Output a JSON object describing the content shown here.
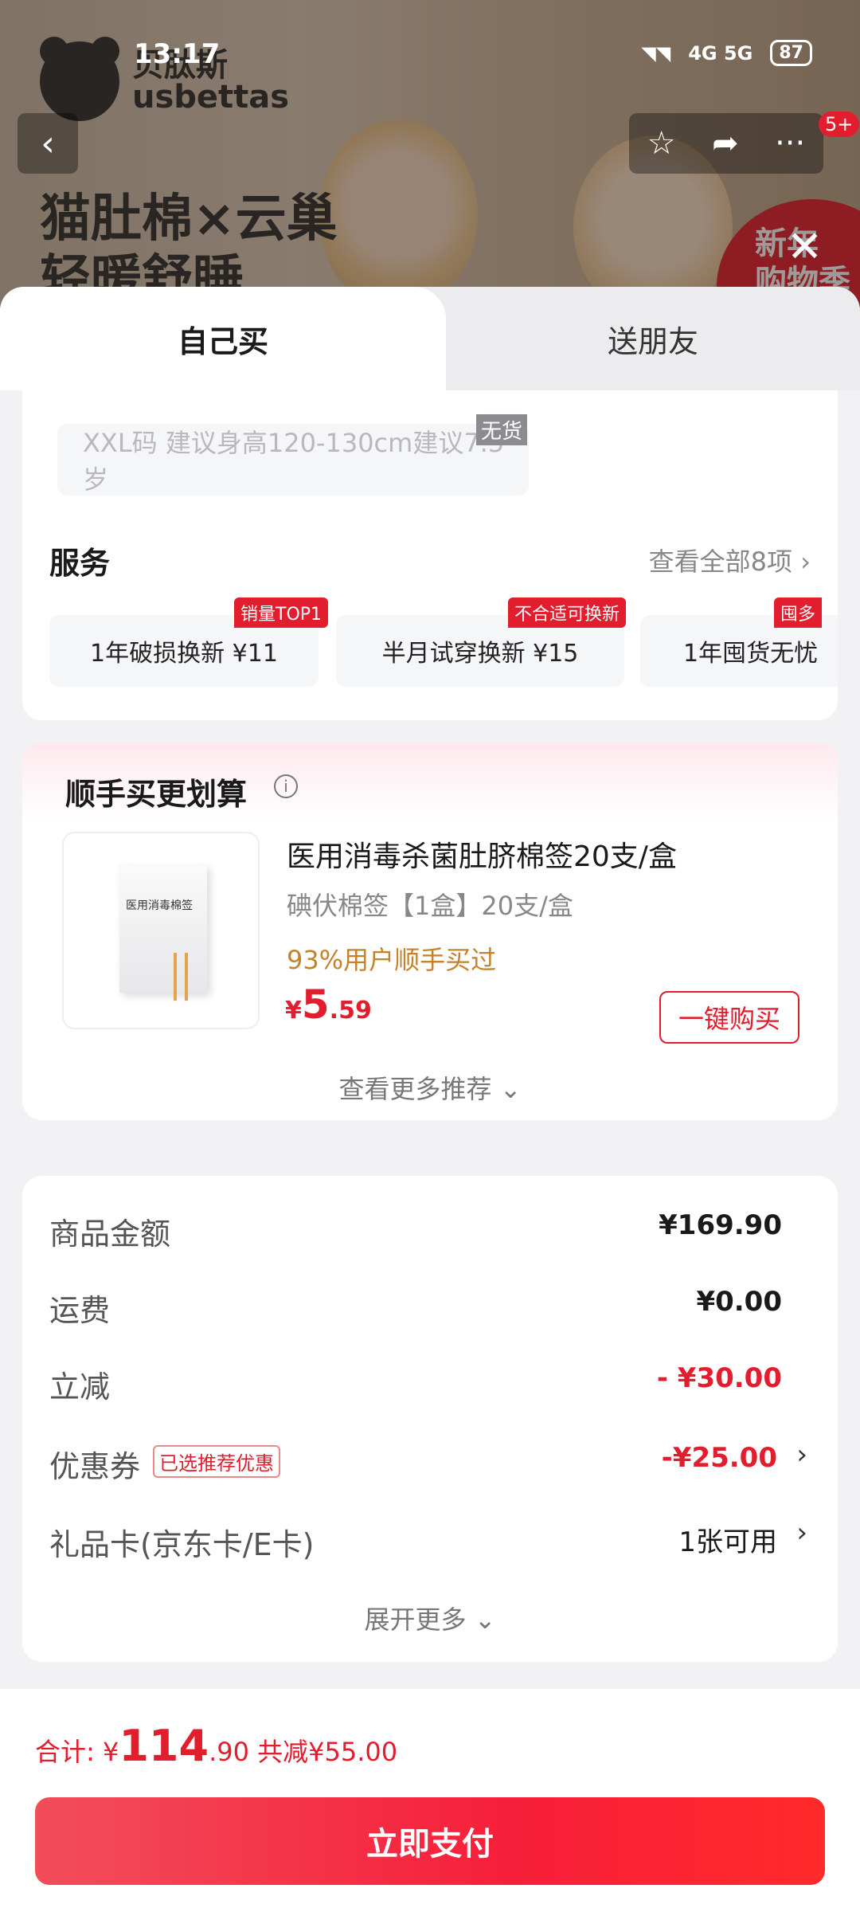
{
  "status_bar": {
    "time": "13:17",
    "network": "4G 5G",
    "battery": "87"
  },
  "banner": {
    "brand_cn": "贝肽斯",
    "brand_en": "usbettas",
    "slogan_line1": "猫肚棉×云巢",
    "slogan_line2": "轻暖舒睡",
    "promo_line1": "新年",
    "promo_line2": "购物季",
    "msg_badge": "5+"
  },
  "tabs": {
    "self": "自己买",
    "friend": "送朋友"
  },
  "size_option": {
    "label": "XXL码 建议身高120-130cm建议7.5岁",
    "stock_tag": "无货"
  },
  "service": {
    "title": "服务",
    "view_all": "查看全部8项",
    "items": [
      {
        "label": "1年破损换新  ¥11",
        "tag": "销量TOP1"
      },
      {
        "label": "半月试穿换新  ¥15",
        "tag": "不合适可换新"
      },
      {
        "label": "1年囤货无忧",
        "tag": "囤多"
      }
    ]
  },
  "addon": {
    "title": "顺手买更划算",
    "product_name": "医用消毒杀菌肚脐棉签20支/盒",
    "product_spec": "碘伏棉签【1盒】20支/盒",
    "buyers": "93%用户顺手买过",
    "price_currency": "¥",
    "price_int": "5",
    "price_dec": ".59",
    "buy_button": "一键购买",
    "more": "查看更多推荐",
    "box_label": "医用消毒棉签"
  },
  "summary": {
    "goods_label": "商品金额",
    "goods_value": "¥169.90",
    "shipping_label": "运费",
    "shipping_value": "¥0.00",
    "discount_label": "立减",
    "discount_value": "- ¥30.00",
    "coupon_label": "优惠券",
    "coupon_tag": "已选推荐优惠",
    "coupon_value": "-¥25.00",
    "giftcard_label": "礼品卡(京东卡/E卡)",
    "giftcard_value": "1张可用",
    "expand": "展开更多"
  },
  "footer": {
    "total_label": "合计: ",
    "total_currency": "¥",
    "total_int": "114",
    "total_dec": ".90",
    "total_saved": " 共减¥55.00",
    "pay_button": "立即支付"
  },
  "colors": {
    "accent": "#e21d2d",
    "gold": "#c4822b"
  }
}
